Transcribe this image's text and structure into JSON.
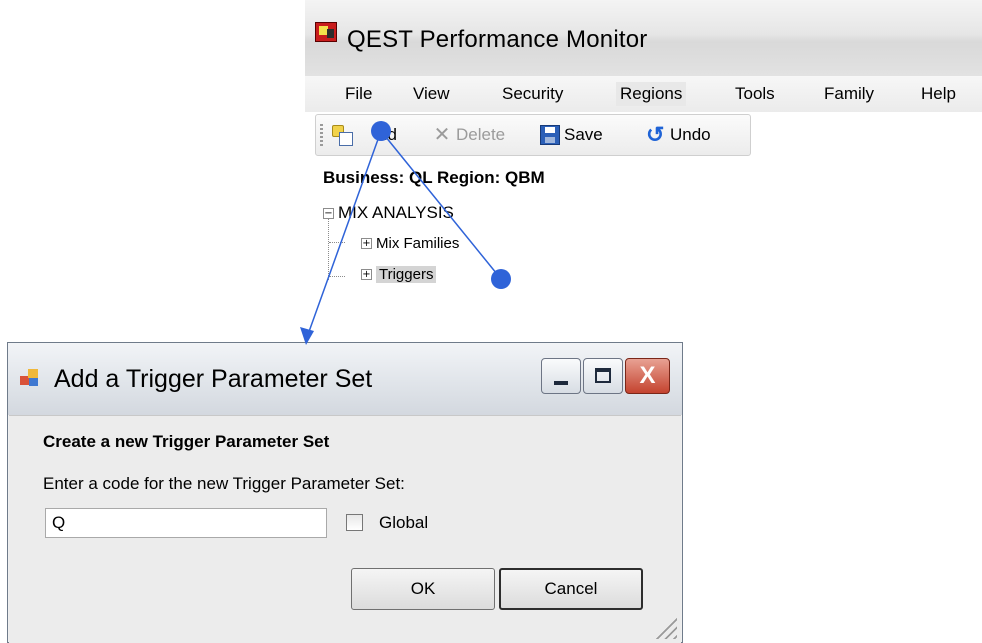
{
  "main_window": {
    "title": "QEST Performance Monitor",
    "menu": [
      "File",
      "View",
      "Security",
      "Regions",
      "Tools",
      "Family",
      "Help"
    ],
    "toolbar": {
      "add_label": "Add",
      "add_label_visible": "dd",
      "delete_label": "Delete",
      "save_label": "Save",
      "undo_label": "Undo"
    },
    "business_line": "Business: QL  Region: QBM",
    "tree": {
      "root": "MIX ANALYSIS",
      "children": [
        "Mix Families",
        "Triggers"
      ],
      "selected": "Triggers"
    }
  },
  "dialog": {
    "title": "Add a Trigger Parameter Set",
    "heading": "Create a new Trigger Parameter Set",
    "prompt": "Enter a code for the new Trigger Parameter Set:",
    "code_value": "Q",
    "global_label": "Global",
    "global_checked": false,
    "ok_label": "OK",
    "cancel_label": "Cancel",
    "close_glyph": "X"
  },
  "colors": {
    "annotation_blue": "#2f63d8",
    "selection_gray": "#d4d4d4",
    "close_red": "#c4432f"
  },
  "icons": [
    "app-logo-icon",
    "add-icon",
    "delete-icon",
    "save-icon",
    "undo-icon",
    "dialog-icon",
    "minimize-icon",
    "maximize-icon",
    "close-icon",
    "resize-grip-icon"
  ]
}
